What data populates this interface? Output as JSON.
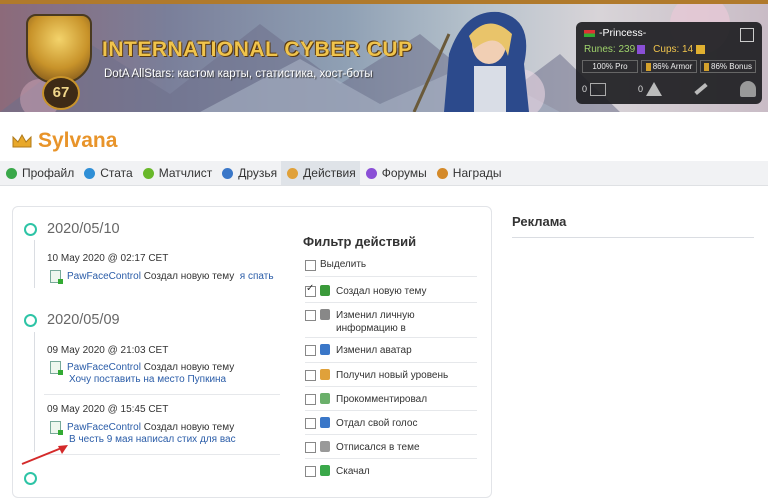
{
  "banner": {
    "title": "INTERNATIONAL CYBER CUP",
    "subtitle": "DotA AllStars: кастом карты, статистика, хост-боты",
    "badge_number": "67"
  },
  "user_panel": {
    "username": "-Princess-",
    "runes_label": "Runes: 239",
    "cups_label": "Cups: 14",
    "stats": [
      "100% Pro",
      "86% Armor",
      "86% Bonus"
    ],
    "messages": "0",
    "alerts": "0"
  },
  "page": {
    "title": "Sylvana"
  },
  "tabs": [
    {
      "label": "Профайл",
      "color": "#3aa84a",
      "active": false
    },
    {
      "label": "Стата",
      "color": "#2f8fd6",
      "active": false
    },
    {
      "label": "Матчлист",
      "color": "#69b82a",
      "active": false
    },
    {
      "label": "Друзья",
      "color": "#3a77c8",
      "active": false
    },
    {
      "label": "Действия",
      "color": "#e0a13a",
      "active": true
    },
    {
      "label": "Форумы",
      "color": "#8a4fd6",
      "active": false
    },
    {
      "label": "Награды",
      "color": "#d48a2a",
      "active": false
    }
  ],
  "timeline": {
    "groups": [
      {
        "date": "2020/05/10",
        "entries": [
          {
            "time": "10 May 2020 @ 02:17 CET",
            "user": "PawFaceControl",
            "action": "Создал новую тему",
            "topic": "я спать"
          }
        ]
      },
      {
        "date": "2020/05/09",
        "entries": [
          {
            "time": "09 May 2020 @ 21:03 CET",
            "user": "PawFaceControl",
            "action": "Создал новую тему",
            "topic": "Хочу поставить на место Пупкина"
          },
          {
            "time": "09 May 2020 @ 15:45 CET",
            "user": "PawFaceControl",
            "action": "Создал новую тему",
            "topic": "В честь 9 мая написал стих для вас"
          }
        ]
      }
    ]
  },
  "filter": {
    "title": "Фильтр действий",
    "select_all": "Выделить",
    "items": [
      {
        "label": "Создал новую тему",
        "checked": true,
        "icon": "new-topic-icon"
      },
      {
        "label": "Изменил личную информацию в",
        "checked": false,
        "icon": "pencil-icon"
      },
      {
        "label": "Изменил аватар",
        "checked": false,
        "icon": "avatar-icon"
      },
      {
        "label": "Получил новый уровень",
        "checked": false,
        "icon": "level-shield-icon"
      },
      {
        "label": "Прокомментировал",
        "checked": false,
        "icon": "comment-icon"
      },
      {
        "label": "Отдал свой голос",
        "checked": false,
        "icon": "vote-chart-icon"
      },
      {
        "label": "Отписался в теме",
        "checked": false,
        "icon": "reply-doc-icon"
      },
      {
        "label": "Скачал",
        "checked": false,
        "icon": "download-icon"
      }
    ]
  },
  "ads": {
    "title": "Реклама"
  }
}
